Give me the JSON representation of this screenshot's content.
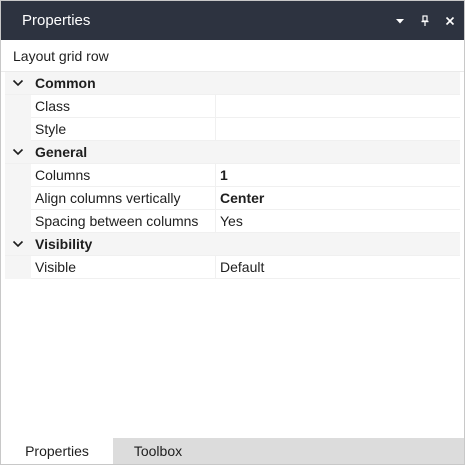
{
  "window": {
    "title": "Properties",
    "controls": {
      "dropdown_icon": "chevron-down-icon",
      "pin_icon": "pin-icon",
      "close_icon": "close-icon"
    }
  },
  "subtitle": "Layout grid row",
  "categories": [
    {
      "label": "Common",
      "expanded": true,
      "properties": [
        {
          "name": "Class",
          "value": "",
          "bold": false
        },
        {
          "name": "Style",
          "value": "",
          "bold": false
        }
      ]
    },
    {
      "label": "General",
      "expanded": true,
      "properties": [
        {
          "name": "Columns",
          "value": "1",
          "bold": true
        },
        {
          "name": "Align columns vertically",
          "value": "Center",
          "bold": true
        },
        {
          "name": "Spacing between columns",
          "value": "Yes",
          "bold": false
        }
      ]
    },
    {
      "label": "Visibility",
      "expanded": true,
      "properties": [
        {
          "name": "Visible",
          "value": "Default",
          "bold": false
        }
      ]
    }
  ],
  "tabs": [
    {
      "label": "Properties",
      "active": true
    },
    {
      "label": "Toolbox",
      "active": false
    }
  ],
  "colors": {
    "titlebar_bg": "#2d3340",
    "category_bg": "#f5f5f5",
    "tabstrip_bg": "#dcdcdc"
  }
}
